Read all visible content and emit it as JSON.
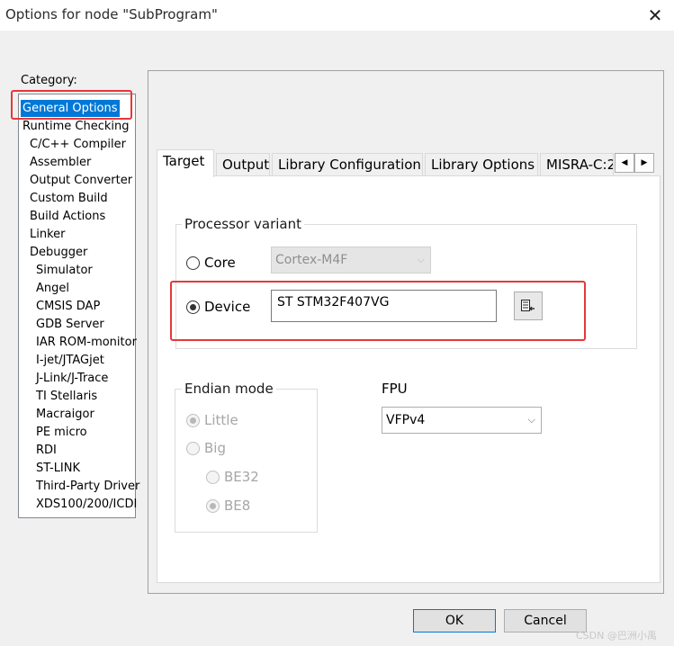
{
  "window": {
    "title": "Options for node \"SubProgram\"",
    "close_glyph": "✕"
  },
  "category": {
    "label": "Category:",
    "items": [
      {
        "label": "General Options",
        "selected": true
      },
      {
        "label": "Runtime Checking"
      },
      {
        "label": "C/C++ Compiler"
      },
      {
        "label": "Assembler"
      },
      {
        "label": "Output Converter"
      },
      {
        "label": "Custom Build"
      },
      {
        "label": "Build Actions"
      },
      {
        "label": "Linker"
      },
      {
        "label": "Debugger"
      },
      {
        "label": "Simulator"
      },
      {
        "label": "Angel"
      },
      {
        "label": "CMSIS DAP"
      },
      {
        "label": "GDB Server"
      },
      {
        "label": "IAR ROM-monitor"
      },
      {
        "label": "I-jet/JTAGjet"
      },
      {
        "label": "J-Link/J-Trace"
      },
      {
        "label": "TI Stellaris"
      },
      {
        "label": "Macraigor"
      },
      {
        "label": "PE micro"
      },
      {
        "label": "RDI"
      },
      {
        "label": "ST-LINK"
      },
      {
        "label": "Third-Party Driver"
      },
      {
        "label": "XDS100/200/ICDI"
      }
    ]
  },
  "tabs": {
    "items": [
      {
        "label": "Target",
        "active": true
      },
      {
        "label": "Output"
      },
      {
        "label": "Library Configuration"
      },
      {
        "label": "Library Options"
      },
      {
        "label": "MISRA-C:2"
      }
    ],
    "scroll_left": "◀",
    "scroll_right": "▶"
  },
  "processor_variant": {
    "title": "Processor variant",
    "core_label": "Core",
    "core_value": "Cortex-M4F",
    "device_label": "Device",
    "device_value": "ST STM32F407VG",
    "selected": "Device"
  },
  "endian_mode": {
    "title": "Endian mode",
    "little_label": "Little",
    "big_label": "Big",
    "be32_label": "BE32",
    "be8_label": "BE8"
  },
  "fpu": {
    "label": "FPU",
    "value": "VFPv4"
  },
  "buttons": {
    "ok": "OK",
    "cancel": "Cancel"
  },
  "watermark": "CSDN @巴洲小禹",
  "colors": {
    "highlight_red": "#e5383b",
    "selection_blue": "#0078d7"
  }
}
